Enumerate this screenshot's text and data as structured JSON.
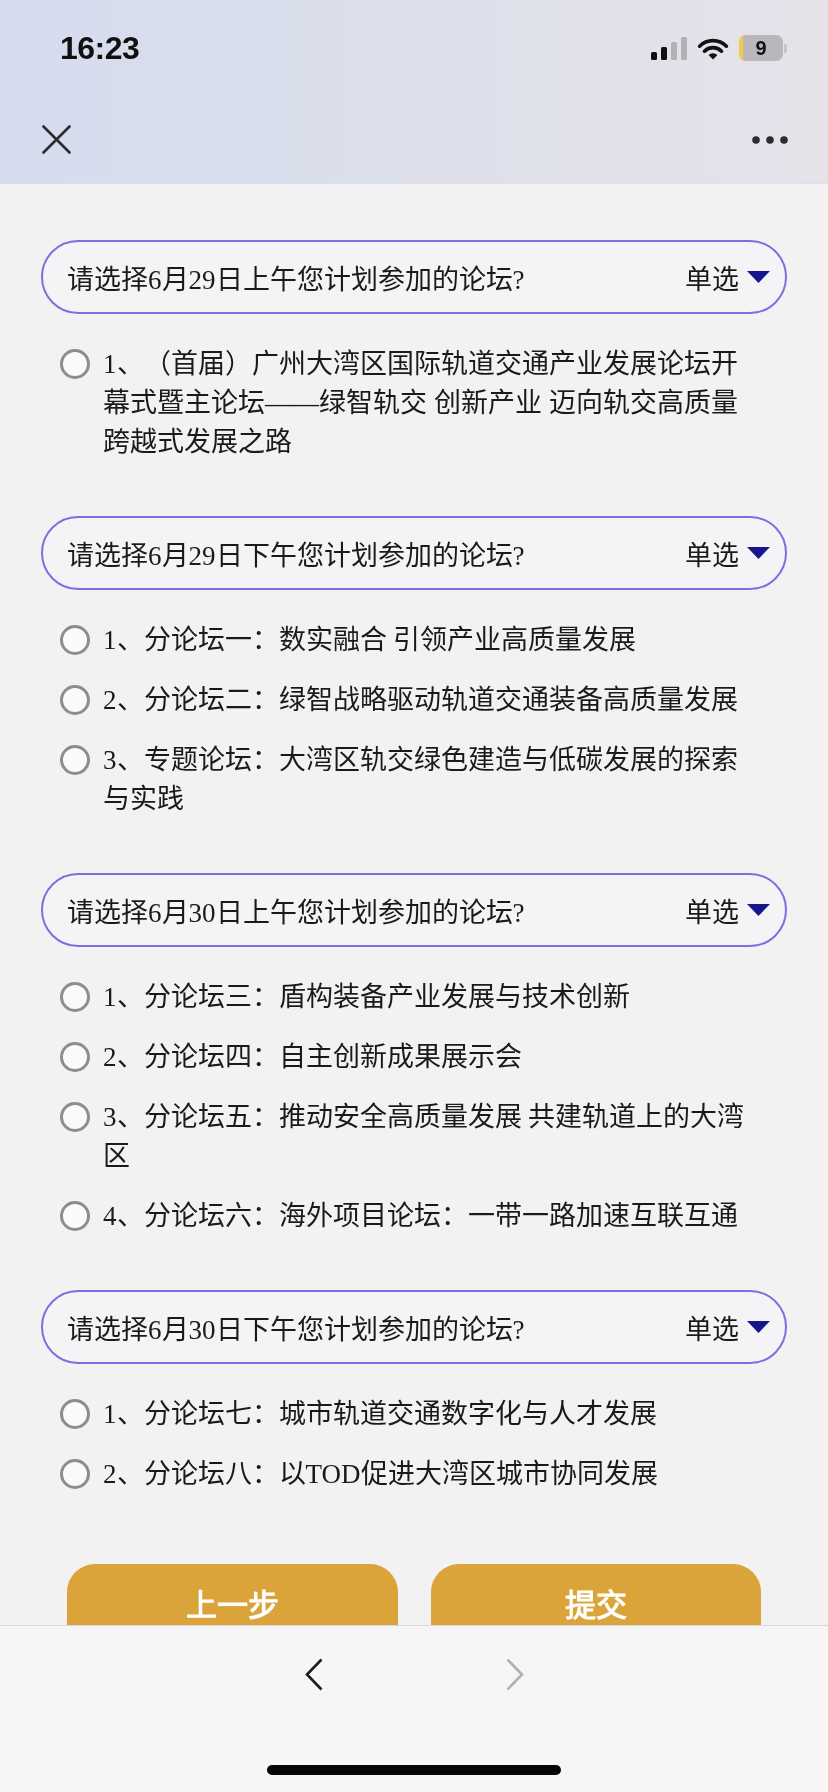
{
  "status_bar": {
    "time": "16:23",
    "battery": "9"
  },
  "questions": [
    {
      "title": "请选择6月29日上午您计划参加的论坛?",
      "type_label": "单选",
      "options": [
        {
          "label": "1、（首届）广州大湾区国际轨道交通产业发展论坛开幕式暨主论坛——绿智轨交 创新产业 迈向轨交高质量跨越式发展之路",
          "selected": false
        }
      ]
    },
    {
      "title": "请选择6月29日下午您计划参加的论坛?",
      "type_label": "单选",
      "options": [
        {
          "label": "1、分论坛一：数实融合 引领产业高质量发展",
          "selected": false
        },
        {
          "label": "2、分论坛二：绿智战略驱动轨道交通装备高质量发展",
          "selected": false
        },
        {
          "label": "3、专题论坛：大湾区轨交绿色建造与低碳发展的探索与实践",
          "selected": false
        }
      ]
    },
    {
      "title": "请选择6月30日上午您计划参加的论坛?",
      "type_label": "单选",
      "options": [
        {
          "label": "1、分论坛三：盾构装备产业发展与技术创新",
          "selected": false
        },
        {
          "label": "2、分论坛四：自主创新成果展示会",
          "selected": false
        },
        {
          "label": "3、分论坛五：推动安全高质量发展 共建轨道上的大湾区",
          "selected": false
        },
        {
          "label": "4、分论坛六：海外项目论坛：一带一路加速互联互通",
          "selected": false
        }
      ]
    },
    {
      "title": "请选择6月30日下午您计划参加的论坛?",
      "type_label": "单选",
      "options": [
        {
          "label": "1、分论坛七：城市轨道交通数字化与人才发展",
          "selected": false
        },
        {
          "label": "2、分论坛八：以TOD促进大湾区城市协同发展",
          "selected": false
        }
      ]
    }
  ],
  "buttons": [
    {
      "label": "上一步"
    },
    {
      "label": "提交"
    }
  ],
  "browser_toolbar": {
    "back": {
      "disabled": false
    },
    "forward": {
      "disabled": true
    }
  }
}
